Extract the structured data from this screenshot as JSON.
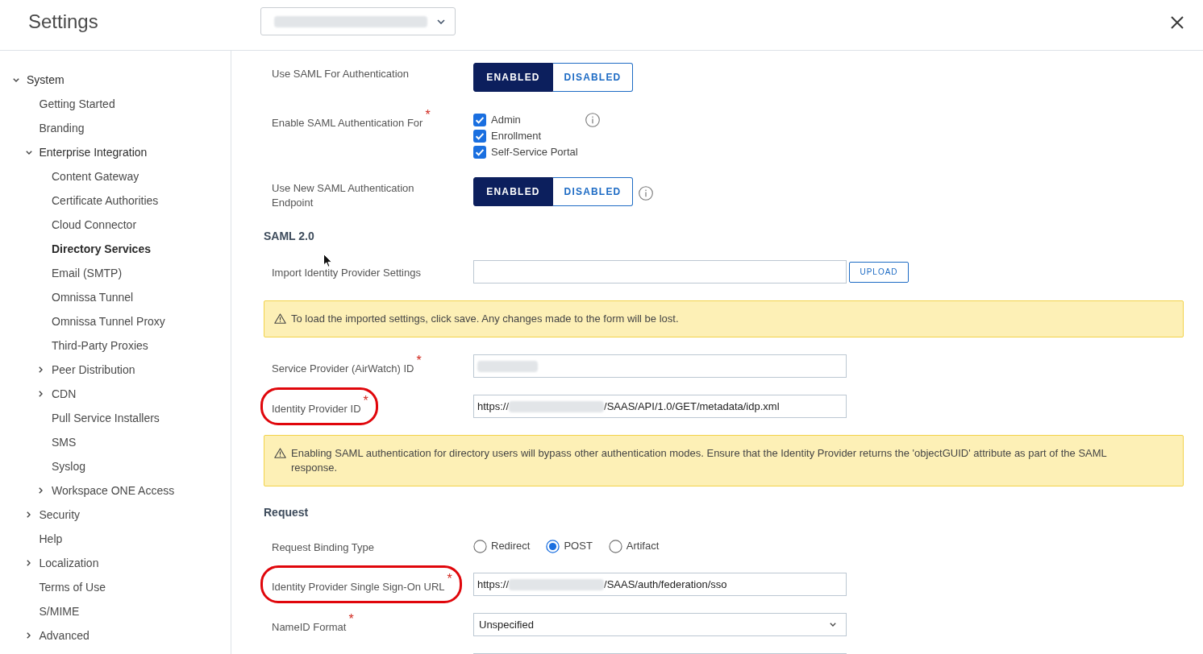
{
  "header": {
    "title": "Settings",
    "dropdown": {
      "value": [
        {
          "kind": "redacted"
        }
      ]
    }
  },
  "sidebar": {
    "items": [
      {
        "label": "System",
        "expanded": true,
        "selected": false,
        "children": [
          {
            "label": "Getting Started",
            "selected": false
          },
          {
            "label": "Branding",
            "selected": false
          },
          {
            "label": "Enterprise Integration",
            "expanded": true,
            "selected": false,
            "children": [
              {
                "label": "Content Gateway",
                "selected": false
              },
              {
                "label": "Certificate Authorities",
                "selected": false
              },
              {
                "label": "Cloud Connector",
                "selected": false
              },
              {
                "label": "Directory Services",
                "selected": true
              },
              {
                "label": "Email (SMTP)",
                "selected": false
              },
              {
                "label": "Omnissa Tunnel",
                "selected": false
              },
              {
                "label": "Omnissa Tunnel Proxy",
                "selected": false
              },
              {
                "label": "Third-Party Proxies",
                "selected": false
              },
              {
                "label": "Peer Distribution",
                "expanded": false,
                "selected": false
              },
              {
                "label": "CDN",
                "expanded": false,
                "selected": false
              },
              {
                "label": "Pull Service Installers",
                "selected": false
              },
              {
                "label": "SMS",
                "selected": false
              },
              {
                "label": "Syslog",
                "selected": false
              },
              {
                "label": "Workspace ONE Access",
                "expanded": false,
                "selected": false
              }
            ]
          },
          {
            "label": "Security",
            "expanded": false,
            "selected": false
          },
          {
            "label": "Help",
            "selected": false
          },
          {
            "label": "Localization",
            "expanded": false,
            "selected": false
          },
          {
            "label": "Terms of Use",
            "selected": false
          },
          {
            "label": "S/MIME",
            "selected": false
          },
          {
            "label": "Advanced",
            "expanded": false,
            "selected": false
          }
        ]
      }
    ]
  },
  "form": {
    "rows": [
      {
        "kind": "toggle",
        "label": "Use SAML For Authentication",
        "info": false,
        "options": [
          {
            "label": "ENABLED",
            "selected": true
          },
          {
            "label": "DISABLED",
            "selected": false
          }
        ]
      },
      {
        "kind": "checkboxes",
        "label": "Enable SAML Authentication For$^{*}$",
        "info": true,
        "options": [
          {
            "label": "Admin",
            "checked": true
          },
          {
            "label": "Enrollment",
            "checked": true
          },
          {
            "label": "Self-Service Portal",
            "checked": true
          }
        ]
      },
      {
        "kind": "toggle",
        "label": "Use New SAML Authentication Endpoint",
        "info": true,
        "options": [
          {
            "label": "ENABLED",
            "selected": true
          },
          {
            "label": "DISABLED",
            "selected": false
          }
        ]
      },
      {
        "kind": "heading",
        "text": "SAML 2.0"
      },
      {
        "kind": "upload",
        "label": "Import Identity Provider Settings",
        "button": "UPLOAD"
      },
      {
        "kind": "notice",
        "text": "To load the imported settings, click save. Any changes made to the form will be lost."
      },
      {
        "kind": "input",
        "label": "Service Provider (AirWatch) ID$^{*}$",
        "highlighted": false,
        "value": [
          {
            "kind": "redacted"
          }
        ]
      },
      {
        "kind": "input",
        "label": "Identity Provider ID$^{*}$",
        "highlighted": true,
        "value": [
          {
            "kind": "text",
            "text": "https://"
          },
          {
            "kind": "redacted"
          },
          {
            "kind": "text",
            "text": "/SAAS/API/1.0/GET/metadata/idp.xml"
          }
        ]
      },
      {
        "kind": "notice",
        "text": "Enabling SAML authentication for directory users will bypass other authentication modes. Ensure that the Identity Provider returns the 'objectGUID' attribute as part of the SAML response."
      },
      {
        "kind": "heading",
        "text": "Request"
      },
      {
        "kind": "radios",
        "label": "Request Binding Type",
        "options": [
          {
            "label": "Redirect",
            "selected": false
          },
          {
            "label": "POST",
            "selected": true
          },
          {
            "label": "Artifact",
            "selected": false
          }
        ]
      },
      {
        "kind": "input",
        "label": "Identity Provider Single Sign-On URL$^{*}$",
        "highlighted": true,
        "value": [
          {
            "kind": "text",
            "text": "https://"
          },
          {
            "kind": "redacted"
          },
          {
            "kind": "text",
            "text": "/SAAS/auth/federation/sso"
          }
        ]
      },
      {
        "kind": "select",
        "label": "NameID Format$^{*}$",
        "value": "Unspecified"
      },
      {
        "kind": "input"
      }
    ]
  }
}
